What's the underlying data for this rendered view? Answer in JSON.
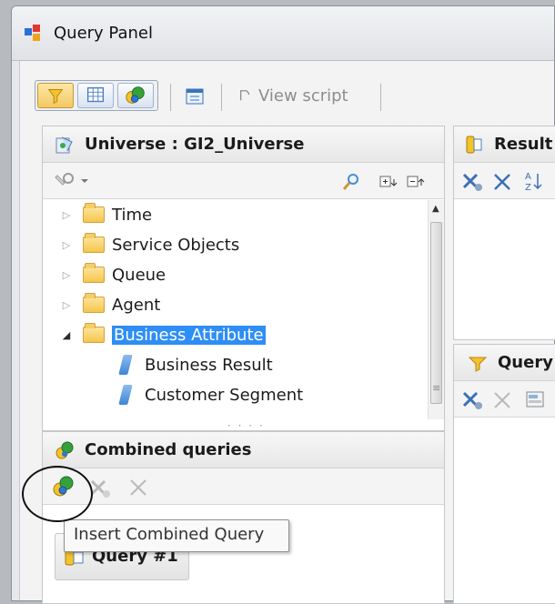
{
  "window": {
    "title": "Query Panel"
  },
  "toolbar": {
    "buttons": [
      "filter",
      "table",
      "combined"
    ],
    "view_script": "View script"
  },
  "universe_panel": {
    "title": "Universe : GI2_Universe",
    "tree": [
      {
        "label": "Time",
        "type": "folder",
        "expanded": false
      },
      {
        "label": "Service Objects",
        "type": "folder",
        "expanded": false
      },
      {
        "label": "Queue",
        "type": "folder",
        "expanded": false
      },
      {
        "label": "Agent",
        "type": "folder",
        "expanded": false
      },
      {
        "label": "Business Attribute",
        "type": "folder",
        "expanded": true,
        "selected": true
      },
      {
        "label": "Business Result",
        "type": "dimension"
      },
      {
        "label": "Customer Segment",
        "type": "dimension"
      }
    ]
  },
  "combined_panel": {
    "title": "Combined queries",
    "tooltip": "Insert Combined Query",
    "query_item": "Query #1"
  },
  "result_panel": {
    "title": "Result"
  },
  "query_filters_panel": {
    "title": "Query"
  },
  "colors": {
    "selection": "#2e8ef5",
    "folder": "#f5c54e",
    "accent_blue": "#3f86d5"
  }
}
